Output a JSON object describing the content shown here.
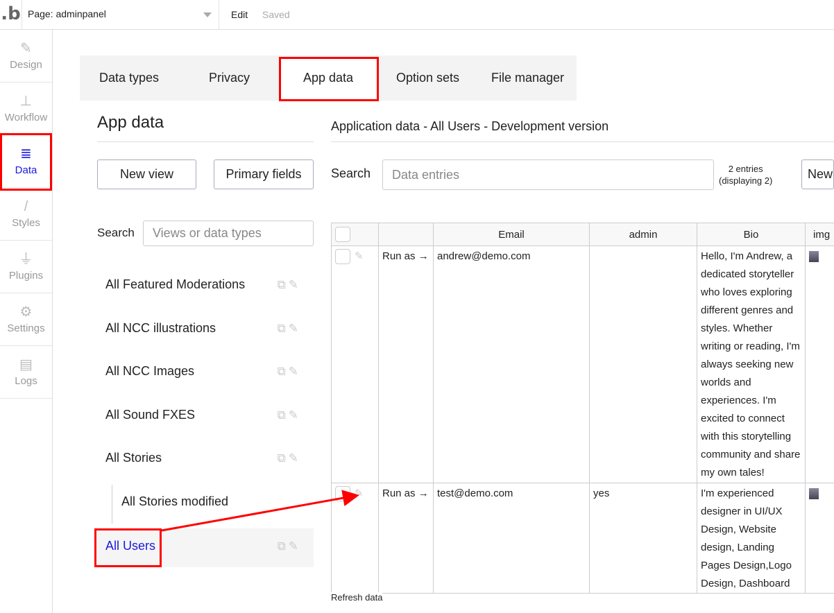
{
  "topbar": {
    "page_label": "Page: adminpanel",
    "edit": "Edit",
    "saved": "Saved"
  },
  "sidebar": {
    "items": [
      {
        "label": "Design",
        "icon": "design-icon"
      },
      {
        "label": "Workflow",
        "icon": "workflow-icon"
      },
      {
        "label": "Data",
        "icon": "database-icon",
        "active": true
      },
      {
        "label": "Styles",
        "icon": "brush-icon"
      },
      {
        "label": "Plugins",
        "icon": "plug-icon"
      },
      {
        "label": "Settings",
        "icon": "gear-icon"
      },
      {
        "label": "Logs",
        "icon": "document-icon"
      }
    ]
  },
  "tabs": [
    "Data types",
    "Privacy",
    "App data",
    "Option sets",
    "File manager"
  ],
  "left": {
    "title": "App data",
    "new_view": "New view",
    "primary_fields": "Primary fields",
    "search_label": "Search",
    "search_placeholder": "Views or data types",
    "views": [
      "All Featured Moderations",
      "All NCC illustrations",
      "All NCC Images",
      "All Sound FXES",
      "All Stories",
      "All Stories modified",
      "All Users"
    ]
  },
  "right": {
    "title": "Application data - All Users - Development version",
    "search_label": "Search",
    "search_placeholder": "Data entries",
    "entries_count": "2 entries",
    "entries_displaying": "(displaying 2)",
    "new_button": "New",
    "columns": [
      "Email",
      "admin",
      "Bio",
      "img"
    ],
    "run_as": "Run as →",
    "rows": [
      {
        "email": "andrew@demo.com",
        "admin": "",
        "bio": "Hello, I'm Andrew, a dedicated storyteller who loves exploring different genres and styles. Whether writing or reading, I'm always seeking new worlds and experiences. I'm excited to connect with this storytelling community and share my own tales!"
      },
      {
        "email": "test@demo.com",
        "admin": "yes",
        "bio": "I'm experienced designer in UI/UX Design, Website design, Landing Pages Design,Logo Design, Dashboard"
      }
    ],
    "refresh": "Refresh data"
  },
  "colors": {
    "accent": "#1a1adb",
    "highlight": "#ff0000"
  }
}
